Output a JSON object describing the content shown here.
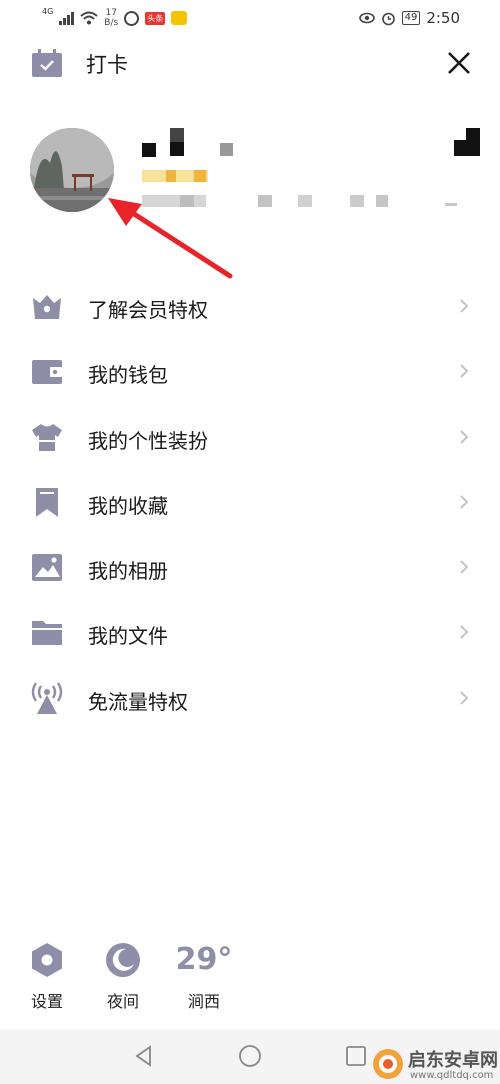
{
  "status_bar": {
    "network": "4G",
    "speed_value": "17",
    "speed_unit": "B/s",
    "news_badge": "头条",
    "battery": "49",
    "time": "2:50"
  },
  "top_bar": {
    "checkin_label": "打卡",
    "checkin_icon": "calendar-check-icon",
    "close_icon": "close-icon"
  },
  "menu": {
    "items": [
      {
        "label": "了解会员特权",
        "icon": "crown-icon"
      },
      {
        "label": "我的钱包",
        "icon": "wallet-icon"
      },
      {
        "label": "我的个性装扮",
        "icon": "tshirt-icon"
      },
      {
        "label": "我的收藏",
        "icon": "bookmark-icon"
      },
      {
        "label": "我的相册",
        "icon": "image-icon"
      },
      {
        "label": "我的文件",
        "icon": "folder-icon"
      },
      {
        "label": "免流量特权",
        "icon": "signal-tower-icon"
      }
    ]
  },
  "bottom": {
    "settings_label": "设置",
    "night_label": "夜间",
    "weather_temp": "29°",
    "weather_city": "涧西"
  },
  "watermark": {
    "brand": "启东安卓网",
    "url": "www.qdltdq.com"
  },
  "colors": {
    "icon": "#8e8ea8",
    "arrow": "#e8232a",
    "text": "#1a1a1a",
    "chevron": "#c4c4c4"
  }
}
